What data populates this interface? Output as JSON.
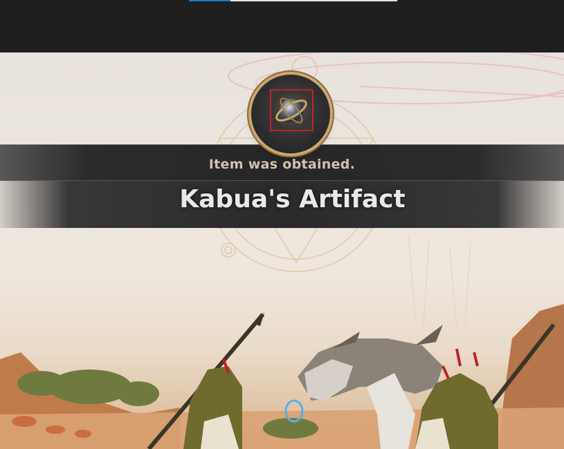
{
  "top_bar": {
    "progress": 0.2
  },
  "notification": {
    "status_text": "Item was obtained.",
    "item_name": "Kabua's Artifact",
    "item_icon": "orb-artifact-icon"
  },
  "colors": {
    "slot_border": "#b3272b",
    "medallion_ring": "#c9a86a",
    "progress_fill": "#1e78d8"
  }
}
